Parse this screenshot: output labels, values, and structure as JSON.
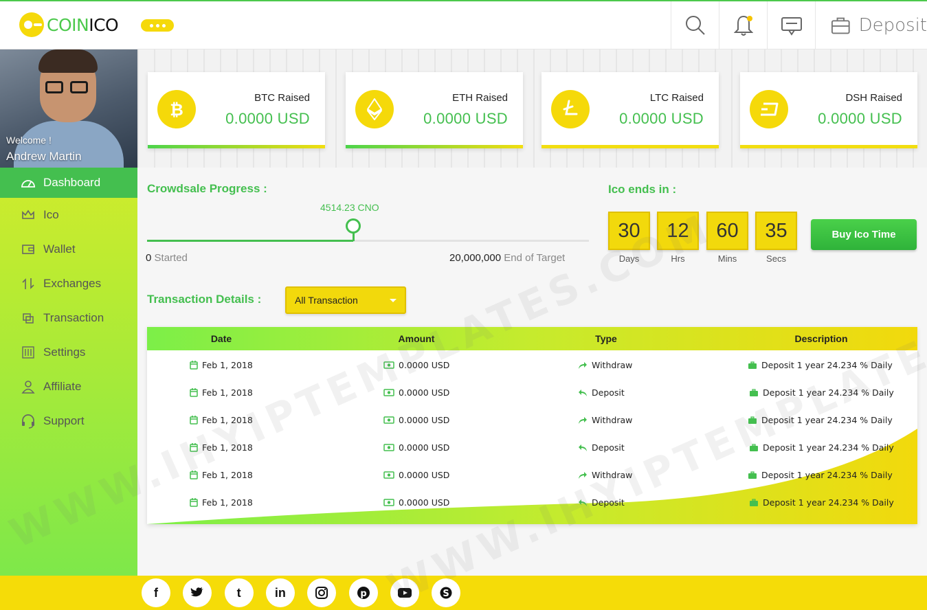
{
  "brand": {
    "logo_part1": "COIN",
    "logo_part2": "ICO"
  },
  "header": {
    "deposit_label": "Deposit"
  },
  "profile": {
    "welcome": "Welcome !",
    "name": "Andrew Martin"
  },
  "sidebar": {
    "items": [
      {
        "label": "Dashboard",
        "icon": "dashboard-icon",
        "active": true
      },
      {
        "label": "Ico",
        "icon": "crown-icon"
      },
      {
        "label": "Wallet",
        "icon": "wallet-icon"
      },
      {
        "label": "Exchanges",
        "icon": "exchange-icon"
      },
      {
        "label": "Transaction",
        "icon": "transaction-icon"
      },
      {
        "label": "Settings",
        "icon": "settings-icon"
      },
      {
        "label": "Affiliate",
        "icon": "user-icon"
      },
      {
        "label": "Support",
        "icon": "headset-icon"
      }
    ]
  },
  "cards": [
    {
      "label": "BTC Raised",
      "value": "0.0000 USD",
      "icon": "bitcoin-icon"
    },
    {
      "label": "ETH Raised",
      "value": "0.0000 USD",
      "icon": "ethereum-icon"
    },
    {
      "label": "LTC Raised",
      "value": "0.0000 USD",
      "icon": "litecoin-icon"
    },
    {
      "label": "DSH Raised",
      "value": "0.0000 USD",
      "icon": "dash-icon"
    }
  ],
  "crowdsale": {
    "title": "Crowdsale Progress :",
    "current": "4514.23 CNO",
    "progress_fraction": 0.467,
    "start_value": "0",
    "start_label": "Started",
    "end_value": "20,000,000",
    "end_label": "End of Target"
  },
  "countdown": {
    "title": "Ico ends in :",
    "units": [
      {
        "value": "30",
        "label": "Days"
      },
      {
        "value": "12",
        "label": "Hrs"
      },
      {
        "value": "60",
        "label": "Mins"
      },
      {
        "value": "35",
        "label": "Secs"
      }
    ],
    "button": "Buy Ico Time"
  },
  "transactions": {
    "title": "Transaction Details :",
    "filter_value": "All Transaction",
    "columns": [
      "Date",
      "Amount",
      "Type",
      "Description"
    ],
    "rows": [
      {
        "date": "Feb 1, 2018",
        "amount": "0.0000 USD",
        "type": "Withdraw",
        "description": "Deposit 1 year 24.234 % Daily"
      },
      {
        "date": "Feb 1, 2018",
        "amount": "0.0000 USD",
        "type": "Deposit",
        "description": "Deposit 1 year 24.234 % Daily"
      },
      {
        "date": "Feb 1, 2018",
        "amount": "0.0000 USD",
        "type": "Withdraw",
        "description": "Deposit 1 year 24.234 % Daily"
      },
      {
        "date": "Feb 1, 2018",
        "amount": "0.0000 USD",
        "type": "Deposit",
        "description": "Deposit 1 year 24.234 % Daily"
      },
      {
        "date": "Feb 1, 2018",
        "amount": "0.0000 USD",
        "type": "Withdraw",
        "description": "Deposit 1 year 24.234 % Daily"
      },
      {
        "date": "Feb 1, 2018",
        "amount": "0.0000 USD",
        "type": "Deposit",
        "description": "Deposit 1 year 24.234 % Daily"
      }
    ]
  },
  "social": [
    {
      "name": "facebook-icon",
      "glyph": "f"
    },
    {
      "name": "twitter-icon",
      "glyph": ""
    },
    {
      "name": "tumblr-icon",
      "glyph": "t"
    },
    {
      "name": "linkedin-icon",
      "glyph": "in"
    },
    {
      "name": "instagram-icon",
      "glyph": ""
    },
    {
      "name": "pinterest-icon",
      "glyph": ""
    },
    {
      "name": "youtube-icon",
      "glyph": ""
    },
    {
      "name": "skype-icon",
      "glyph": ""
    }
  ],
  "watermark": "WWW.IHYIPTEMPLATES.COM",
  "colors": {
    "green": "#44bf4f",
    "yellow": "#f5d90a",
    "lime": "#c6eb2d"
  }
}
